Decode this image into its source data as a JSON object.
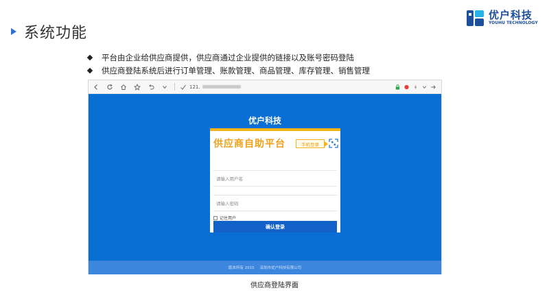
{
  "slide": {
    "title": "系统功能",
    "bullets": [
      "平台由企业给供应商提供，供应商通过企业提供的链接以及账号密码登陆",
      "供应商登陆系统后进行订单管理、账款管理、商品管理、库存管理、销售管理"
    ],
    "caption": "供应商登陆界面"
  },
  "logo": {
    "name_cn": "优户科技",
    "name_en": "YOUHU TECHNOLOGY"
  },
  "browser": {
    "url_prefix": "121."
  },
  "portal": {
    "site_title": "优户科技",
    "card_title": "供应商自助平台",
    "mobile_login": "手机登录",
    "username_placeholder": "请输入用户名",
    "password_placeholder": "请输入密码",
    "remember_label": "记住用户",
    "confirm_button": "确认登录",
    "footer_left": "版本所有 2015",
    "footer_right": "深圳市优户科技有限公司"
  },
  "colors": {
    "accent_blue": "#0a6fd4",
    "card_orange": "#f5b31a",
    "button_blue": "#1161c9",
    "logo_blue": "#1c4f9c"
  }
}
